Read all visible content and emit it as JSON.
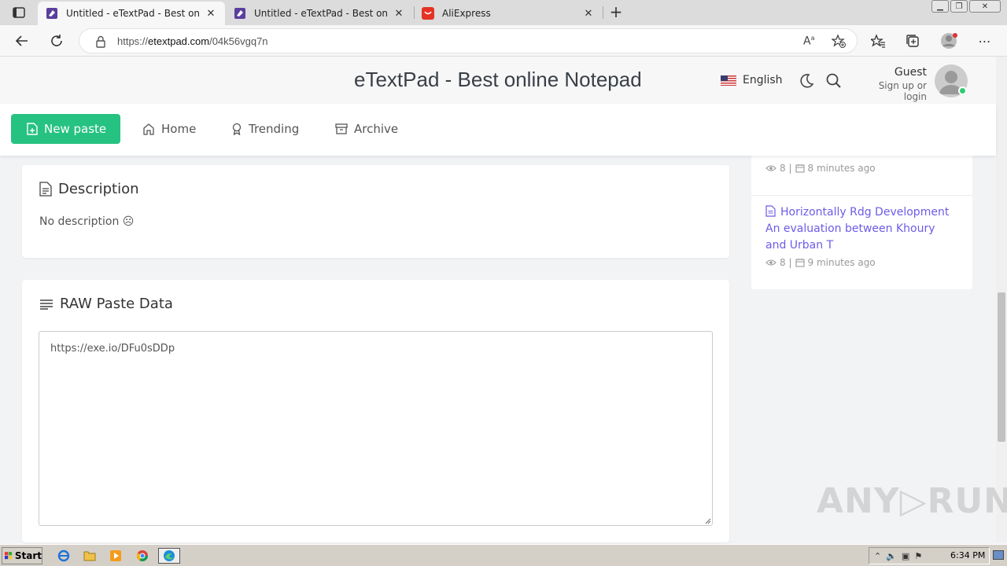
{
  "browser": {
    "tabs": [
      {
        "title": "Untitled - eTextPad - Best online N",
        "active": true,
        "favicon": "etextpad-icon"
      },
      {
        "title": "Untitled - eTextPad - Best online N",
        "active": false,
        "favicon": "etextpad-icon"
      },
      {
        "title": "AliExpress",
        "active": false,
        "favicon": "aliexpress-icon"
      }
    ],
    "url_prefix": "https://",
    "url_domain": "etextpad.com",
    "url_path": "/04k56vgq7n"
  },
  "header": {
    "site_title": "eTextPad - Best online Notepad",
    "language": "English",
    "user_name": "Guest",
    "user_sub": "Sign up or login"
  },
  "nav": {
    "new_paste": "New paste",
    "home": "Home",
    "trending": "Trending",
    "archive": "Archive"
  },
  "description": {
    "title": "Description",
    "text": "No description ☹"
  },
  "raw": {
    "title": "RAW Paste Data",
    "content": "https://exe.io/DFu0sDDp"
  },
  "sidebar": {
    "items": [
      {
        "views": "8 |",
        "time": "8 minutes ago"
      },
      {
        "title": "Horizontally Rdg Development An evaluation between Khoury and Urban T",
        "views": "8 |",
        "time": "9 minutes ago"
      }
    ]
  },
  "watermark": "ANY▷RUN",
  "taskbar": {
    "start": "Start",
    "clock": "6:34 PM"
  },
  "colors": {
    "accent_green": "#26c281",
    "link_purple": "#6c5ce7"
  }
}
